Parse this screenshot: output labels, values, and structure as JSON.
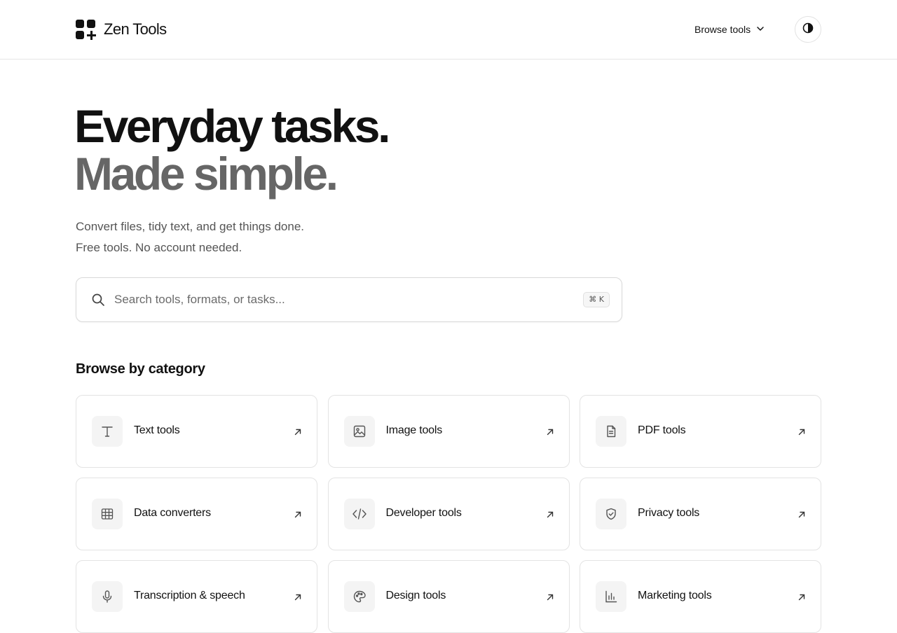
{
  "header": {
    "brand_name": "Zen Tools",
    "logo_icon": "grid-plus-logo-icon",
    "browse_label": "Browse tools",
    "browse_icon": "chevron-down-icon",
    "theme_icon": "contrast-icon"
  },
  "hero": {
    "line1": "Everyday tasks.",
    "line2": "Made simple.",
    "subtitle_line1": "Convert files, tidy text, and get things done.",
    "subtitle_line2": "Free tools. No account needed."
  },
  "search": {
    "placeholder": "Search tools, formats, or tasks...",
    "value": "",
    "shortcut": "⌘ K",
    "icon": "search-icon"
  },
  "categories": {
    "title": "Browse by category",
    "items": [
      {
        "label": "Text tools",
        "icon": "text-icon"
      },
      {
        "label": "Image tools",
        "icon": "image-icon"
      },
      {
        "label": "PDF tools",
        "icon": "document-icon"
      },
      {
        "label": "Data converters",
        "icon": "table-icon"
      },
      {
        "label": "Developer tools",
        "icon": "code-icon"
      },
      {
        "label": "Privacy tools",
        "icon": "shield-check-icon"
      },
      {
        "label": "Transcription & speech",
        "icon": "microphone-icon"
      },
      {
        "label": "Design tools",
        "icon": "palette-icon"
      },
      {
        "label": "Marketing tools",
        "icon": "bar-chart-icon"
      }
    ]
  },
  "colors": {
    "text_primary": "#111111",
    "text_secondary": "#666666",
    "border": "#e3e3e3",
    "icon_bg": "#f4f4f4"
  }
}
